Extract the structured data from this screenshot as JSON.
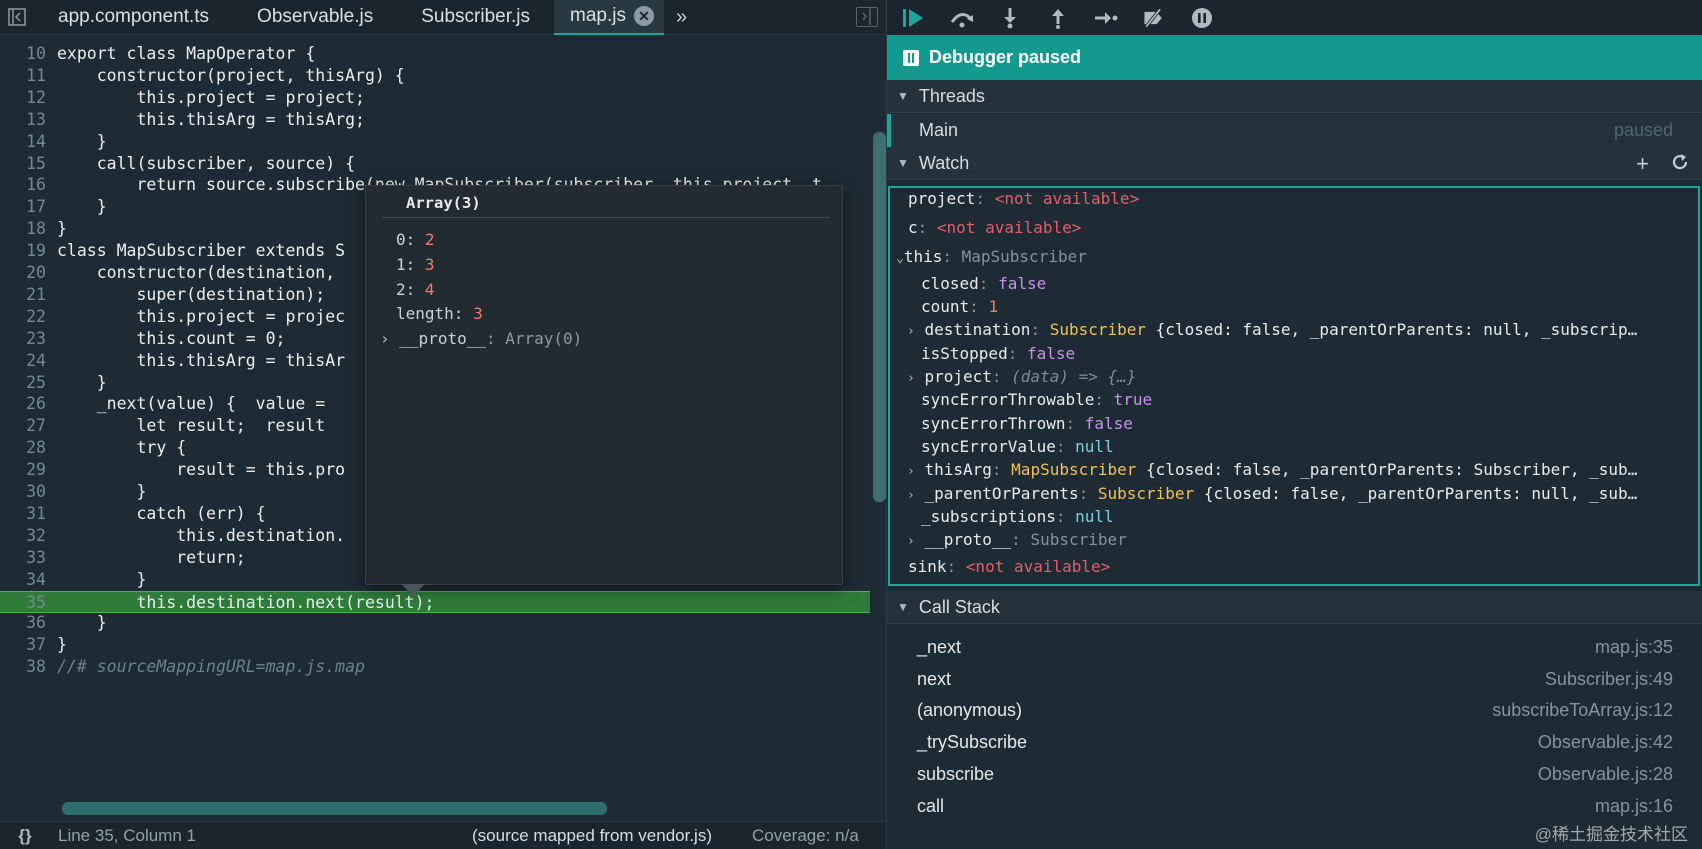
{
  "editor": {
    "tabs": [
      "app.component.ts",
      "Observable.js",
      "Subscriber.js",
      "map.js"
    ],
    "active_tab": "map.js",
    "lines": [
      {
        "n": "10",
        "t": "export class MapOperator {"
      },
      {
        "n": "11",
        "t": "    constructor(project, thisArg) {"
      },
      {
        "n": "12",
        "t": "        this.project = project;"
      },
      {
        "n": "13",
        "t": "        this.thisArg = thisArg;"
      },
      {
        "n": "14",
        "t": "    }"
      },
      {
        "n": "15",
        "t": "    call(subscriber, source) {"
      },
      {
        "n": "16",
        "t": "        return source.subscribe(new MapSubscriber(subscriber, this.project, t"
      },
      {
        "n": "17",
        "t": "    }"
      },
      {
        "n": "18",
        "t": "}"
      },
      {
        "n": "19",
        "t": "class MapSubscriber extends S"
      },
      {
        "n": "20",
        "t": "    constructor(destination,"
      },
      {
        "n": "21",
        "t": "        super(destination);"
      },
      {
        "n": "22",
        "t": "        this.project = projec"
      },
      {
        "n": "23",
        "t": "        this.count = 0;"
      },
      {
        "n": "24",
        "t": "        this.thisArg = thisAr"
      },
      {
        "n": "25",
        "t": "    }"
      },
      {
        "n": "26",
        "t": "    _next(value) {  value ="
      },
      {
        "n": "27",
        "t": "        let result;  result"
      },
      {
        "n": "28",
        "t": "        try {"
      },
      {
        "n": "29",
        "t": "            result = this.pro"
      },
      {
        "n": "30",
        "t": "        }"
      },
      {
        "n": "31",
        "t": "        catch (err) {"
      },
      {
        "n": "32",
        "t": "            this.destination."
      },
      {
        "n": "33",
        "t": "            return;"
      },
      {
        "n": "34",
        "t": "        }"
      },
      {
        "n": "35",
        "t": "        this.destination.next(result);"
      },
      {
        "n": "36",
        "t": "    }"
      },
      {
        "n": "37",
        "t": "}"
      },
      {
        "n": "38",
        "t": "//# sourceMappingURL=map.js.map"
      }
    ],
    "highlighted_line": "35",
    "popover": {
      "title": "Array(3)",
      "rows": [
        {
          "k": "0",
          "v": "2"
        },
        {
          "k": "1",
          "v": "3"
        },
        {
          "k": "2",
          "v": "4"
        },
        {
          "k": "length",
          "v": "3"
        }
      ],
      "proto_key": "__proto__",
      "proto_val": "Array(0)"
    },
    "status": {
      "braces": "{}",
      "position": "Line 35, Column 1",
      "mapped": "(source mapped from vendor.js)",
      "coverage": "Coverage: n/a"
    }
  },
  "debugger": {
    "banner": "Debugger paused",
    "threads": {
      "label": "Threads",
      "main": "Main",
      "status": "paused"
    },
    "watch": {
      "label": "Watch",
      "project": {
        "k": "project",
        "v": "<not available>"
      },
      "c": {
        "k": "c",
        "v": "<not available>"
      },
      "this": {
        "k": "this",
        "v": "MapSubscriber"
      },
      "props": [
        {
          "k": "closed",
          "v": "false"
        },
        {
          "k": "count",
          "v": "1"
        },
        {
          "k": "destination",
          "v": "Subscriber",
          "extra": "{closed: false, _parentOrParents: null, _subscrip…"
        },
        {
          "k": "isStopped",
          "v": "false"
        },
        {
          "k": "project",
          "v": "(data) => {…}"
        },
        {
          "k": "syncErrorThrowable",
          "v": "true"
        },
        {
          "k": "syncErrorThrown",
          "v": "false"
        },
        {
          "k": "syncErrorValue",
          "v": "null"
        },
        {
          "k": "thisArg",
          "v": "MapSubscriber",
          "extra": "{closed: false, _parentOrParents: Subscriber, _sub…"
        },
        {
          "k": "_parentOrParents",
          "v": "Subscriber",
          "extra": "{closed: false, _parentOrParents: null, _sub…"
        },
        {
          "k": "_subscriptions",
          "v": "null"
        },
        {
          "k": "__proto__",
          "v": "Subscriber"
        }
      ],
      "sink": {
        "k": "sink",
        "v": "<not available>"
      }
    },
    "call_stack": {
      "label": "Call Stack",
      "frames": [
        {
          "fn": "_next",
          "loc": "map.js:35"
        },
        {
          "fn": "next",
          "loc": "Subscriber.js:49"
        },
        {
          "fn": "(anonymous)",
          "loc": "subscribeToArray.js:12"
        },
        {
          "fn": "_trySubscribe",
          "loc": "Observable.js:42"
        },
        {
          "fn": "subscribe",
          "loc": "Observable.js:28"
        },
        {
          "fn": "call",
          "loc": "map.js:16"
        }
      ]
    },
    "watermark": "@稀土掘金技术社区"
  },
  "colors": {
    "accent": "#1aa89c",
    "highlight_line": "#2f7c3a",
    "not_available": "#e0606a",
    "class_name": "#f2c155"
  }
}
